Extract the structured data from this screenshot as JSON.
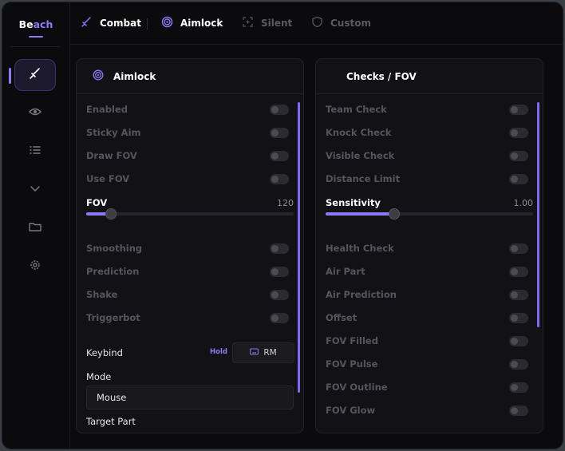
{
  "brand": {
    "part1": "Be",
    "part2": "ach"
  },
  "tabs": [
    {
      "label": "Combat",
      "icon": "sword-icon",
      "active": true
    },
    {
      "label": "Aimlock",
      "icon": "target-icon",
      "active": true
    },
    {
      "label": "Silent",
      "icon": "crosshair-icon",
      "active": false
    },
    {
      "label": "Custom",
      "icon": "shield-icon",
      "active": false
    }
  ],
  "sidebar": {
    "items": [
      {
        "icon": "sword-icon",
        "active": true
      },
      {
        "icon": "eye-icon",
        "active": false
      },
      {
        "icon": "list-icon",
        "active": false
      },
      {
        "icon": "chevron-down-icon",
        "active": false
      },
      {
        "icon": "folder-icon",
        "active": false
      },
      {
        "icon": "gear-icon",
        "active": false
      }
    ]
  },
  "left_panel": {
    "title": "Aimlock",
    "toggles_top": [
      "Enabled",
      "Sticky Aim",
      "Draw FOV",
      "Use FOV"
    ],
    "fov": {
      "label": "FOV",
      "value_text": "120",
      "fraction": 0.12
    },
    "toggles_bottom": [
      "Smoothing",
      "Prediction",
      "Shake",
      "Triggerbot"
    ],
    "keybind": {
      "label": "Keybind",
      "mode_tag": "Hold",
      "key": "RM"
    },
    "mode": {
      "label": "Mode",
      "value": "Mouse"
    },
    "target_part": {
      "label": "Target Part"
    }
  },
  "right_panel": {
    "title": "Checks / FOV",
    "toggles_top": [
      "Team Check",
      "Knock Check",
      "Visible Check",
      "Distance Limit"
    ],
    "sensitivity": {
      "label": "Sensitivity",
      "value_text": "1.00",
      "fraction": 0.33
    },
    "toggles_bottom": [
      "Health Check",
      "Air Part",
      "Air Prediction",
      "Offset",
      "FOV Filled",
      "FOV Pulse",
      "FOV Outline",
      "FOV Glow"
    ]
  },
  "colors": {
    "accent": "#8b7cf6",
    "window_bg": "#0b0b0e",
    "panel_bg": "#121216"
  }
}
